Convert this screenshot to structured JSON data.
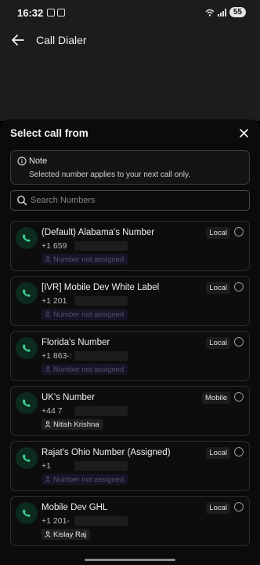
{
  "status": {
    "time": "16:32",
    "battery": "55"
  },
  "app": {
    "title": "Call Dialer"
  },
  "sheet": {
    "title": "Select call from",
    "note_title": "Note",
    "note_text": "Selected number applies to your next call only.",
    "search_placeholder": "Search Numbers"
  },
  "numbers": [
    {
      "name": "(Default) Alabama's Number",
      "number": "+1 659",
      "type": "Local",
      "assignee": "Number not assigned"
    },
    {
      "name": "[IVR] Mobile Dev White Label",
      "number": "+1 201",
      "type": "Local",
      "assignee": "Number not assigned"
    },
    {
      "name": "Florida's Number",
      "number": "+1 863-:",
      "type": "Local",
      "assignee": "Number not assigned"
    },
    {
      "name": "UK's Number",
      "number": "+44 7",
      "type": "Mobile",
      "assignee": "Nitish Krishna"
    },
    {
      "name": "Rajat's Ohio Number (Assigned)",
      "number": "+1",
      "type": "Local",
      "assignee": "Number not assigned"
    },
    {
      "name": "Mobile Dev GHL",
      "number": "+1 201-",
      "type": "Local",
      "assignee": "Kislay Raj"
    }
  ],
  "colors": {
    "accent_green": "#3ecf8e",
    "sheet_bg": "#0b0b0b",
    "header_bg": "#1c1c1c"
  }
}
